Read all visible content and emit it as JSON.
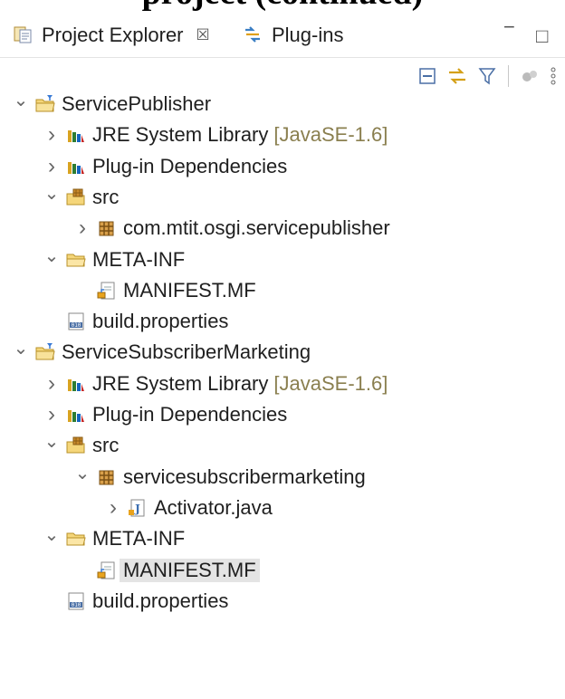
{
  "header_text": "project (continued)",
  "tabs": [
    {
      "label": "Project Explorer",
      "icon": "project-explorer-icon",
      "active": true,
      "close": "☒"
    },
    {
      "label": "Plug-ins",
      "icon": "plugins-icon",
      "active": false
    }
  ],
  "window_controls": {
    "minimize": "−",
    "maximize": "□"
  },
  "toolbar_icons": [
    "collapse-all-icon",
    "link-with-editor-icon",
    "filter-icon",
    "focus-icon",
    "view-menu-icon"
  ],
  "tree": [
    {
      "label": "ServicePublisher",
      "decoration": "",
      "icon": "plugin-project-icon",
      "depth": 0,
      "expanded": true,
      "hasChildren": true
    },
    {
      "label": "JRE System Library",
      "decoration": "[JavaSE-1.6]",
      "icon": "library-icon",
      "depth": 1,
      "expanded": false,
      "hasChildren": true
    },
    {
      "label": "Plug-in Dependencies",
      "decoration": "",
      "icon": "library-icon",
      "depth": 1,
      "expanded": false,
      "hasChildren": true
    },
    {
      "label": "src",
      "decoration": "",
      "icon": "source-folder-icon",
      "depth": 1,
      "expanded": true,
      "hasChildren": true
    },
    {
      "label": "com.mtit.osgi.servicepublisher",
      "decoration": "",
      "icon": "package-icon",
      "depth": 2,
      "expanded": false,
      "hasChildren": true
    },
    {
      "label": "META-INF",
      "decoration": "",
      "icon": "folder-icon",
      "depth": 1,
      "expanded": true,
      "hasChildren": true
    },
    {
      "label": "MANIFEST.MF",
      "decoration": "",
      "icon": "manifest-icon",
      "depth": 2,
      "expanded": false,
      "hasChildren": false
    },
    {
      "label": "build.properties",
      "decoration": "",
      "icon": "properties-file-icon",
      "depth": 1,
      "expanded": false,
      "hasChildren": false
    },
    {
      "label": "ServiceSubscriberMarketing",
      "decoration": "",
      "icon": "plugin-project-icon",
      "depth": 0,
      "expanded": true,
      "hasChildren": true
    },
    {
      "label": "JRE System Library",
      "decoration": "[JavaSE-1.6]",
      "icon": "library-icon",
      "depth": 1,
      "expanded": false,
      "hasChildren": true
    },
    {
      "label": "Plug-in Dependencies",
      "decoration": "",
      "icon": "library-icon",
      "depth": 1,
      "expanded": false,
      "hasChildren": true
    },
    {
      "label": "src",
      "decoration": "",
      "icon": "source-folder-icon",
      "depth": 1,
      "expanded": true,
      "hasChildren": true
    },
    {
      "label": "servicesubscribermarketing",
      "decoration": "",
      "icon": "package-icon",
      "depth": 2,
      "expanded": true,
      "hasChildren": true
    },
    {
      "label": "Activator.java",
      "decoration": "",
      "icon": "java-file-icon",
      "depth": 3,
      "expanded": false,
      "hasChildren": true
    },
    {
      "label": "META-INF",
      "decoration": "",
      "icon": "folder-icon",
      "depth": 1,
      "expanded": true,
      "hasChildren": true
    },
    {
      "label": "MANIFEST.MF",
      "decoration": "",
      "icon": "manifest-icon",
      "depth": 2,
      "expanded": false,
      "hasChildren": false,
      "selected": true
    },
    {
      "label": "build.properties",
      "decoration": "",
      "icon": "properties-file-icon",
      "depth": 1,
      "expanded": false,
      "hasChildren": false
    }
  ]
}
